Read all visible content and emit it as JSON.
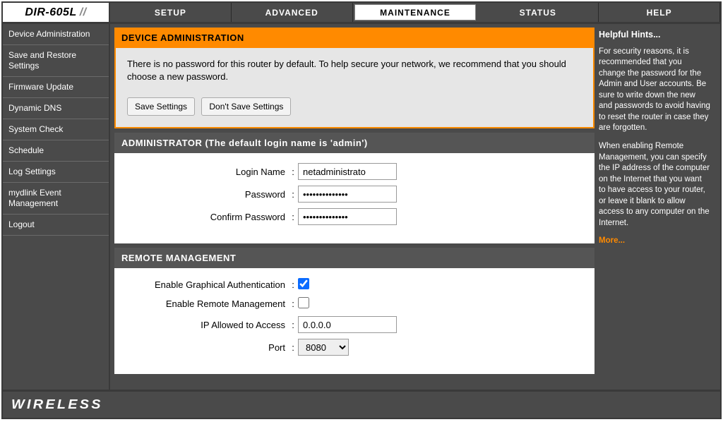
{
  "model": "DIR-605L",
  "tabs": [
    "SETUP",
    "ADVANCED",
    "MAINTENANCE",
    "STATUS",
    "HELP"
  ],
  "active_tab": "MAINTENANCE",
  "sidebar": {
    "items": [
      "Device Administration",
      "Save and Restore Settings",
      "Firmware Update",
      "Dynamic DNS",
      "System Check",
      "Schedule",
      "Log Settings",
      "mydlink Event Management",
      "Logout"
    ]
  },
  "alert": {
    "title": "DEVICE ADMINISTRATION",
    "message": "There is no password for this router by default. To help secure your network, we recommend that you should choose a new password.",
    "save_label": "Save Settings",
    "nosave_label": "Don't Save Settings"
  },
  "admin": {
    "title": "ADMINISTRATOR (The default login name is 'admin')",
    "login_label": "Login Name",
    "login_value": "netadministrato",
    "password_label": "Password",
    "password_value": "••••••••••••••",
    "confirm_label": "Confirm Password",
    "confirm_value": "••••••••••••••"
  },
  "remote": {
    "title": "REMOTE MANAGEMENT",
    "graphical_label": "Enable Graphical Authentication",
    "graphical_checked": true,
    "remote_label": "Enable Remote Management",
    "remote_checked": false,
    "ip_label": "IP Allowed to Access",
    "ip_value": "0.0.0.0",
    "port_label": "Port",
    "port_value": "8080"
  },
  "hints": {
    "title": "Helpful Hints...",
    "p1": "For security reasons, it is recommended that you change the password for the Admin and User accounts. Be sure to write down the new and passwords to avoid having to reset the router in case they are forgotten.",
    "p2": "When enabling Remote Management, you can specify the IP address of the computer on the Internet that you want to have access to your router, or leave it blank to allow access to any computer on the Internet.",
    "more": "More..."
  },
  "footer": "WIRELESS"
}
